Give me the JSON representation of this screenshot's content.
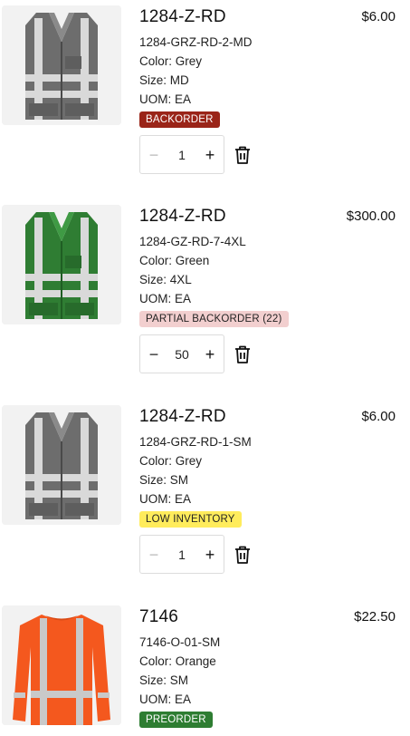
{
  "items": [
    {
      "title": "1284-Z-RD",
      "price": "$6.00",
      "sku": "1284-GRZ-RD-2-MD",
      "color": "Color: Grey",
      "size": "Size: MD",
      "uom": "UOM: EA",
      "badge": "BACKORDER",
      "quantity": "1",
      "minus": "−",
      "plus": "+",
      "image": "grey-safety-vest"
    },
    {
      "title": "1284-Z-RD",
      "price": "$300.00",
      "sku": "1284-GZ-RD-7-4XL",
      "color": "Color: Green",
      "size": "Size: 4XL",
      "uom": "UOM: EA",
      "badge": "PARTIAL BACKORDER (22)",
      "quantity": "50",
      "minus": "−",
      "plus": "+",
      "image": "green-safety-vest"
    },
    {
      "title": "1284-Z-RD",
      "price": "$6.00",
      "sku": "1284-GRZ-RD-1-SM",
      "color": "Color: Grey",
      "size": "Size: SM",
      "uom": "UOM: EA",
      "badge": "LOW INVENTORY",
      "quantity": "1",
      "minus": "−",
      "plus": "+",
      "image": "grey-safety-vest"
    },
    {
      "title": "7146",
      "price": "$22.50",
      "sku": "7146-O-01-SM",
      "color": "Color: Orange",
      "size": "Size: SM",
      "uom": "UOM: EA",
      "badge": "PREORDER",
      "image": "orange-long-sleeve-shirt"
    }
  ],
  "colors": {
    "backorder": "#9a2418",
    "partial_backorder": "#f2cfcf",
    "low_inventory": "#ffec5c",
    "preorder": "#2e7d32"
  }
}
